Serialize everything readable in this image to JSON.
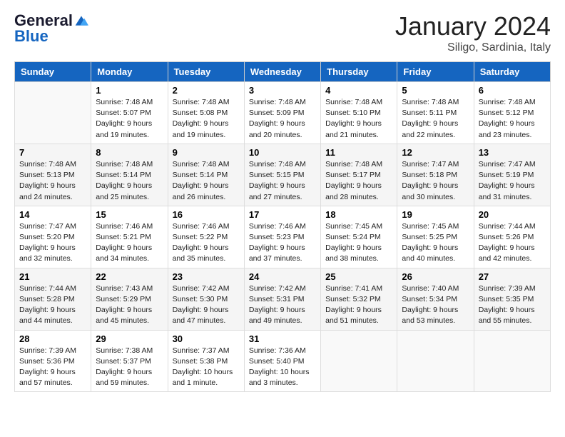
{
  "header": {
    "logo_general": "General",
    "logo_blue": "Blue",
    "month_title": "January 2024",
    "location": "Siligo, Sardinia, Italy"
  },
  "days_of_week": [
    "Sunday",
    "Monday",
    "Tuesday",
    "Wednesday",
    "Thursday",
    "Friday",
    "Saturday"
  ],
  "weeks": [
    [
      {
        "day": "",
        "sunrise": "",
        "sunset": "",
        "daylight": ""
      },
      {
        "day": "1",
        "sunrise": "Sunrise: 7:48 AM",
        "sunset": "Sunset: 5:07 PM",
        "daylight": "Daylight: 9 hours and 19 minutes."
      },
      {
        "day": "2",
        "sunrise": "Sunrise: 7:48 AM",
        "sunset": "Sunset: 5:08 PM",
        "daylight": "Daylight: 9 hours and 19 minutes."
      },
      {
        "day": "3",
        "sunrise": "Sunrise: 7:48 AM",
        "sunset": "Sunset: 5:09 PM",
        "daylight": "Daylight: 9 hours and 20 minutes."
      },
      {
        "day": "4",
        "sunrise": "Sunrise: 7:48 AM",
        "sunset": "Sunset: 5:10 PM",
        "daylight": "Daylight: 9 hours and 21 minutes."
      },
      {
        "day": "5",
        "sunrise": "Sunrise: 7:48 AM",
        "sunset": "Sunset: 5:11 PM",
        "daylight": "Daylight: 9 hours and 22 minutes."
      },
      {
        "day": "6",
        "sunrise": "Sunrise: 7:48 AM",
        "sunset": "Sunset: 5:12 PM",
        "daylight": "Daylight: 9 hours and 23 minutes."
      }
    ],
    [
      {
        "day": "7",
        "sunrise": "Sunrise: 7:48 AM",
        "sunset": "Sunset: 5:13 PM",
        "daylight": "Daylight: 9 hours and 24 minutes."
      },
      {
        "day": "8",
        "sunrise": "Sunrise: 7:48 AM",
        "sunset": "Sunset: 5:14 PM",
        "daylight": "Daylight: 9 hours and 25 minutes."
      },
      {
        "day": "9",
        "sunrise": "Sunrise: 7:48 AM",
        "sunset": "Sunset: 5:14 PM",
        "daylight": "Daylight: 9 hours and 26 minutes."
      },
      {
        "day": "10",
        "sunrise": "Sunrise: 7:48 AM",
        "sunset": "Sunset: 5:15 PM",
        "daylight": "Daylight: 9 hours and 27 minutes."
      },
      {
        "day": "11",
        "sunrise": "Sunrise: 7:48 AM",
        "sunset": "Sunset: 5:17 PM",
        "daylight": "Daylight: 9 hours and 28 minutes."
      },
      {
        "day": "12",
        "sunrise": "Sunrise: 7:47 AM",
        "sunset": "Sunset: 5:18 PM",
        "daylight": "Daylight: 9 hours and 30 minutes."
      },
      {
        "day": "13",
        "sunrise": "Sunrise: 7:47 AM",
        "sunset": "Sunset: 5:19 PM",
        "daylight": "Daylight: 9 hours and 31 minutes."
      }
    ],
    [
      {
        "day": "14",
        "sunrise": "Sunrise: 7:47 AM",
        "sunset": "Sunset: 5:20 PM",
        "daylight": "Daylight: 9 hours and 32 minutes."
      },
      {
        "day": "15",
        "sunrise": "Sunrise: 7:46 AM",
        "sunset": "Sunset: 5:21 PM",
        "daylight": "Daylight: 9 hours and 34 minutes."
      },
      {
        "day": "16",
        "sunrise": "Sunrise: 7:46 AM",
        "sunset": "Sunset: 5:22 PM",
        "daylight": "Daylight: 9 hours and 35 minutes."
      },
      {
        "day": "17",
        "sunrise": "Sunrise: 7:46 AM",
        "sunset": "Sunset: 5:23 PM",
        "daylight": "Daylight: 9 hours and 37 minutes."
      },
      {
        "day": "18",
        "sunrise": "Sunrise: 7:45 AM",
        "sunset": "Sunset: 5:24 PM",
        "daylight": "Daylight: 9 hours and 38 minutes."
      },
      {
        "day": "19",
        "sunrise": "Sunrise: 7:45 AM",
        "sunset": "Sunset: 5:25 PM",
        "daylight": "Daylight: 9 hours and 40 minutes."
      },
      {
        "day": "20",
        "sunrise": "Sunrise: 7:44 AM",
        "sunset": "Sunset: 5:26 PM",
        "daylight": "Daylight: 9 hours and 42 minutes."
      }
    ],
    [
      {
        "day": "21",
        "sunrise": "Sunrise: 7:44 AM",
        "sunset": "Sunset: 5:28 PM",
        "daylight": "Daylight: 9 hours and 44 minutes."
      },
      {
        "day": "22",
        "sunrise": "Sunrise: 7:43 AM",
        "sunset": "Sunset: 5:29 PM",
        "daylight": "Daylight: 9 hours and 45 minutes."
      },
      {
        "day": "23",
        "sunrise": "Sunrise: 7:42 AM",
        "sunset": "Sunset: 5:30 PM",
        "daylight": "Daylight: 9 hours and 47 minutes."
      },
      {
        "day": "24",
        "sunrise": "Sunrise: 7:42 AM",
        "sunset": "Sunset: 5:31 PM",
        "daylight": "Daylight: 9 hours and 49 minutes."
      },
      {
        "day": "25",
        "sunrise": "Sunrise: 7:41 AM",
        "sunset": "Sunset: 5:32 PM",
        "daylight": "Daylight: 9 hours and 51 minutes."
      },
      {
        "day": "26",
        "sunrise": "Sunrise: 7:40 AM",
        "sunset": "Sunset: 5:34 PM",
        "daylight": "Daylight: 9 hours and 53 minutes."
      },
      {
        "day": "27",
        "sunrise": "Sunrise: 7:39 AM",
        "sunset": "Sunset: 5:35 PM",
        "daylight": "Daylight: 9 hours and 55 minutes."
      }
    ],
    [
      {
        "day": "28",
        "sunrise": "Sunrise: 7:39 AM",
        "sunset": "Sunset: 5:36 PM",
        "daylight": "Daylight: 9 hours and 57 minutes."
      },
      {
        "day": "29",
        "sunrise": "Sunrise: 7:38 AM",
        "sunset": "Sunset: 5:37 PM",
        "daylight": "Daylight: 9 hours and 59 minutes."
      },
      {
        "day": "30",
        "sunrise": "Sunrise: 7:37 AM",
        "sunset": "Sunset: 5:38 PM",
        "daylight": "Daylight: 10 hours and 1 minute."
      },
      {
        "day": "31",
        "sunrise": "Sunrise: 7:36 AM",
        "sunset": "Sunset: 5:40 PM",
        "daylight": "Daylight: 10 hours and 3 minutes."
      },
      {
        "day": "",
        "sunrise": "",
        "sunset": "",
        "daylight": ""
      },
      {
        "day": "",
        "sunrise": "",
        "sunset": "",
        "daylight": ""
      },
      {
        "day": "",
        "sunrise": "",
        "sunset": "",
        "daylight": ""
      }
    ]
  ]
}
